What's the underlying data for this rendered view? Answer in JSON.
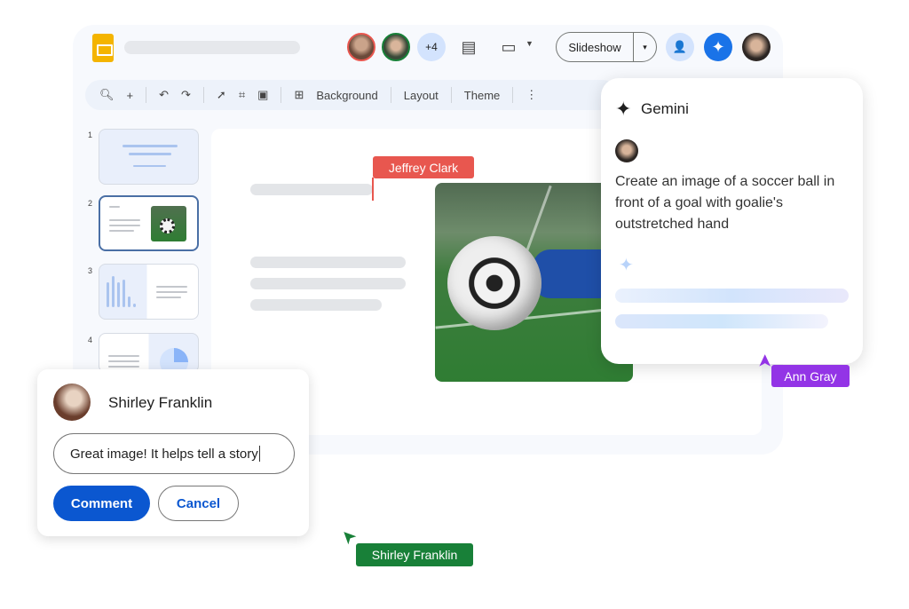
{
  "header": {
    "collaborator_count": "+4",
    "slideshow_label": "Slideshow"
  },
  "toolbar": {
    "background": "Background",
    "layout": "Layout",
    "theme": "Theme"
  },
  "filmstrip": {
    "numbers": [
      "1",
      "2",
      "3",
      "4"
    ]
  },
  "cursors": {
    "jeffrey": "Jeffrey Clark",
    "ann": "Ann Gray",
    "shirley": "Shirley Franklin"
  },
  "gemini": {
    "title": "Gemini",
    "prompt": "Create an image of a soccer ball in front of a goal with goalie's outstretched hand"
  },
  "comment": {
    "author": "Shirley Franklin",
    "input_value": "Great image! It helps tell a story",
    "comment_label": "Comment",
    "cancel_label": "Cancel"
  },
  "colors": {
    "jeffrey": "#e8574f",
    "ann": "#9334e6",
    "shirley": "#188038",
    "primary": "#0b57d0"
  }
}
